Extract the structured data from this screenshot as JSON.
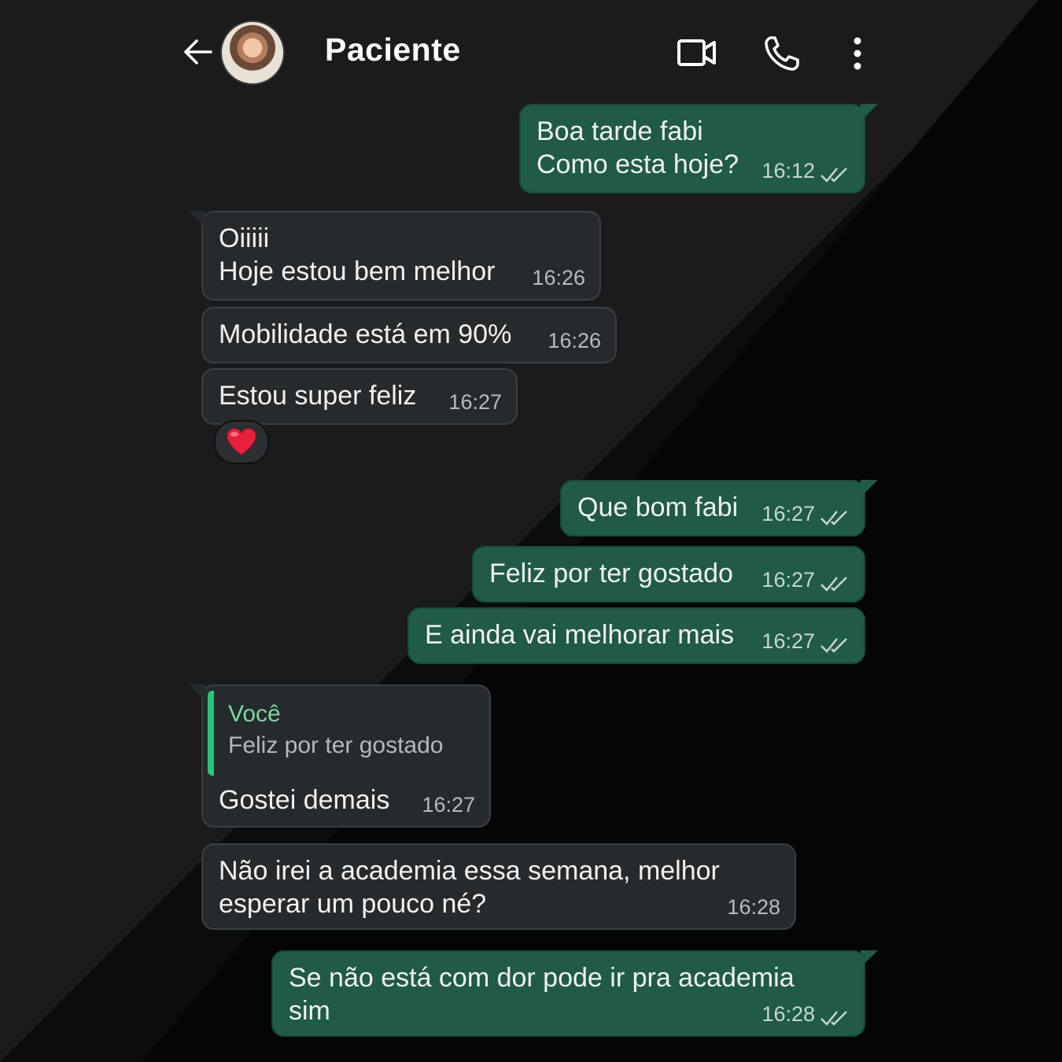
{
  "header": {
    "contact_name": "Paciente"
  },
  "icons": {
    "back": "arrow-left",
    "video": "video-camera",
    "call": "phone",
    "menu": "vertical-dots",
    "read_receipt": "double-check"
  },
  "colors": {
    "incoming_bubble": "#262a2c",
    "outgoing_bubble": "#1f5b45",
    "quote_bar": "#2fc27a",
    "background": "#0c0c0c"
  },
  "messages": [
    {
      "direction": "out",
      "lines": [
        "Boa tarde fabi",
        "Como esta hoje?"
      ],
      "time": "16:12"
    },
    {
      "direction": "in",
      "lines": [
        "Oiiiii",
        "Hoje estou bem melhor"
      ],
      "time": "16:26"
    },
    {
      "direction": "in",
      "lines": [
        "Mobilidade está em 90%"
      ],
      "time": "16:26"
    },
    {
      "direction": "in",
      "lines": [
        "Estou super feliz"
      ],
      "time": "16:27",
      "reaction": "❤️"
    },
    {
      "direction": "out",
      "lines": [
        "Que bom fabi"
      ],
      "time": "16:27"
    },
    {
      "direction": "out",
      "lines": [
        "Feliz por ter gostado"
      ],
      "time": "16:27"
    },
    {
      "direction": "out",
      "lines": [
        "E ainda vai melhorar mais"
      ],
      "time": "16:27"
    },
    {
      "direction": "in",
      "reply_to": {
        "author": "Você",
        "text": "Feliz por ter gostado"
      },
      "lines": [
        "Gostei demais"
      ],
      "time": "16:27"
    },
    {
      "direction": "in",
      "lines": [
        "Não irei a academia essa semana, melhor",
        "esperar um pouco né?"
      ],
      "time": "16:28"
    },
    {
      "direction": "out",
      "lines": [
        "Se não está com dor pode ir pra academia",
        "sim"
      ],
      "time": "16:28"
    }
  ]
}
